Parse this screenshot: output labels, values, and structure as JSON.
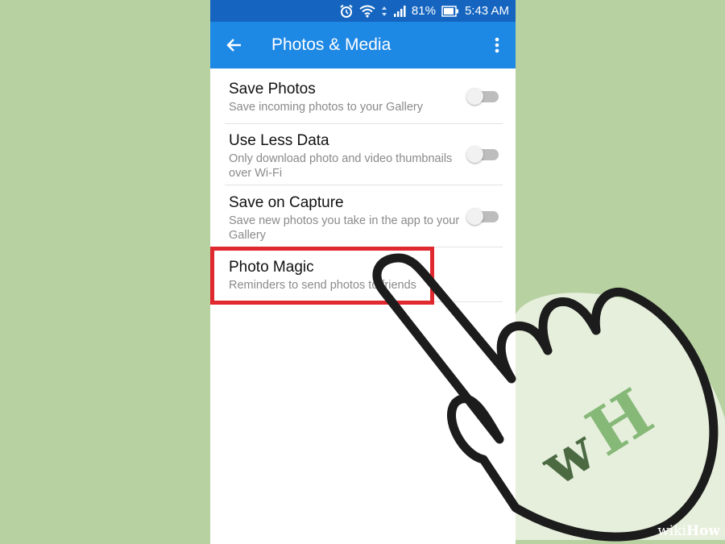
{
  "status_bar": {
    "battery": "81%",
    "time": "5:43 AM",
    "icons": [
      "alarm-icon",
      "wifi-icon",
      "signal-icon",
      "battery-icon"
    ]
  },
  "app_bar": {
    "title": "Photos & Media",
    "back_icon": "arrow-left-icon",
    "menu_icon": "more-vertical-icon"
  },
  "settings": [
    {
      "title": "Save Photos",
      "description": "Save incoming photos to your Gallery",
      "toggle": "off"
    },
    {
      "title": "Use Less Data",
      "description": "Only download photo and video thumbnails over Wi-Fi",
      "toggle": "off"
    },
    {
      "title": "Save on Capture",
      "description": "Save new photos you take in the app to your Gallery",
      "toggle": "off"
    },
    {
      "title": "Photo Magic",
      "description": "Reminders to send photos to friends",
      "toggle": null
    }
  ],
  "watermark": {
    "prefix": "wiki",
    "suffix": "How",
    "logo": "wH"
  },
  "colors": {
    "app_bar": "#1e88e5",
    "status_bar": "#1565c0",
    "highlight": "#e0282f",
    "background": "#b7d1a1"
  }
}
